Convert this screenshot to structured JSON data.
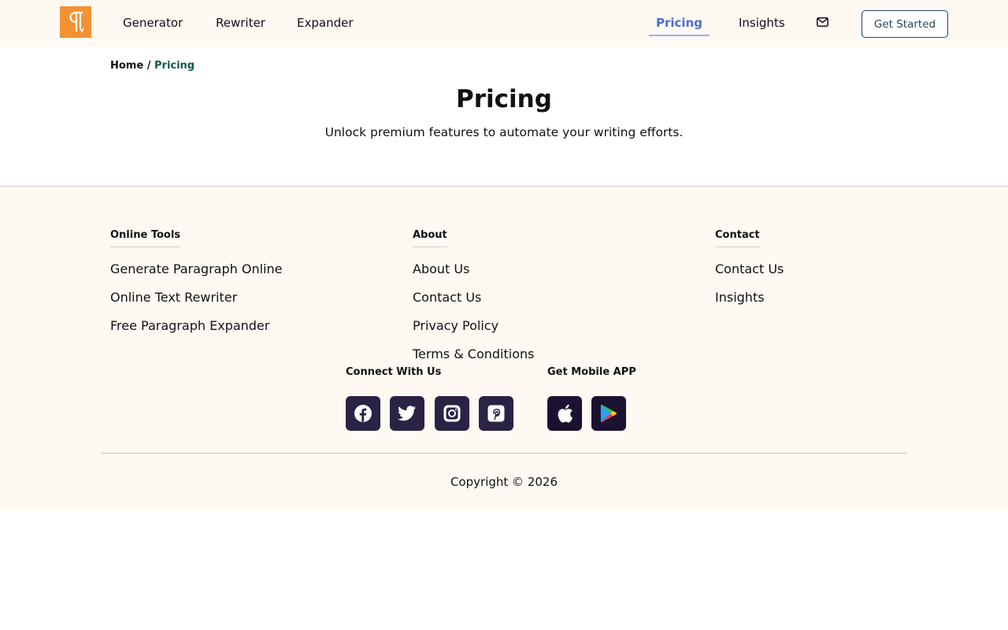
{
  "header": {
    "logo_icon": "pilcrow-pen-icon",
    "nav": {
      "generator": "Generator",
      "rewriter": "Rewriter",
      "expander": "Expander",
      "pricing": "Pricing",
      "insights": "Insights"
    },
    "mail_icon": "envelope-icon",
    "cta": "Get Started"
  },
  "breadcrumb": {
    "home": "Home",
    "separator": "/",
    "current": "Pricing"
  },
  "hero": {
    "title": "Pricing",
    "subtitle": "Unlock premium features to automate your writing efforts."
  },
  "footer": {
    "columns": [
      {
        "heading": "Online Tools",
        "links": [
          "Generate Paragraph Online",
          "Online Text Rewriter",
          "Free Paragraph Expander"
        ]
      },
      {
        "heading": "About",
        "links": [
          "About Us",
          "Contact Us",
          "Privacy Policy",
          "Terms & Conditions"
        ]
      },
      {
        "heading": "Contact",
        "links": [
          "Contact Us",
          "Insights"
        ]
      }
    ],
    "connect_heading": "Connect With Us",
    "social_icons": [
      "facebook-icon",
      "twitter-icon",
      "instagram-icon",
      "pinterest-icon"
    ],
    "app_heading": "Get Mobile APP",
    "app_icons": [
      "apple-icon",
      "google-play-icon"
    ],
    "copyright": "Copyright © 2026"
  },
  "colors": {
    "accent": "#f39232",
    "active_nav": "#4b6bd6",
    "breadcrumb_current": "#0f5a4a",
    "social_bg": "#2a2346",
    "footer_bg": "#fff9f4"
  }
}
